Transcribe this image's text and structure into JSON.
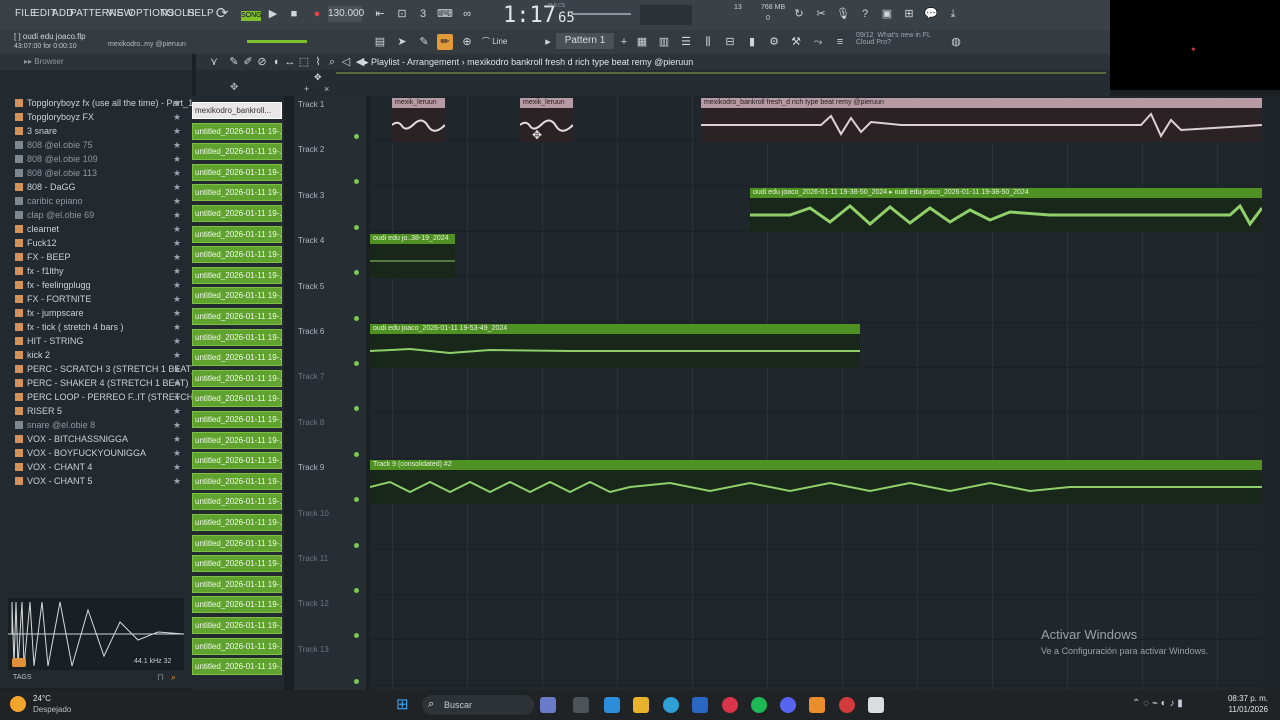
{
  "menu": [
    "FILE",
    "EDIT",
    "ADD",
    "PATTERNS",
    "VIEW",
    "OPTIONS",
    "TOOLS",
    "HELP"
  ],
  "transport": {
    "song_badge": "SONG",
    "tempo": "130.000",
    "time": "1:17",
    "time_sub": "65",
    "time_tag": "M:S:CS",
    "cpu": "13",
    "mem": "768 MB",
    "mem2": "0"
  },
  "project": {
    "file": "oudi edu joaco.flp",
    "elapsed": "43:07:00 for 0:00:10",
    "hint": "mexikodro..my @pieruun"
  },
  "toolbar2": {
    "line_mode": "Line",
    "pattern": "Pattern 1",
    "news_date": "09/12",
    "news_text1": "What's new in FL",
    "news_text2": "Cloud Pro?"
  },
  "browser": {
    "title": "Browser",
    "items": [
      {
        "name": "Topgloryboyz fx (use all the time) - Part_1",
        "dim": false
      },
      {
        "name": "Topgloryboyz FX",
        "dim": false
      },
      {
        "name": "3 snare",
        "dim": false
      },
      {
        "name": "808 @el.obie 75",
        "dim": true
      },
      {
        "name": "808 @el.obie 109",
        "dim": true
      },
      {
        "name": "808 @el.obie 113",
        "dim": true
      },
      {
        "name": "808 - DaGG",
        "dim": false
      },
      {
        "name": "caribic epiano",
        "dim": true
      },
      {
        "name": "clap @el.obie 69",
        "dim": true
      },
      {
        "name": "clearnet",
        "dim": false
      },
      {
        "name": "Fuck12",
        "dim": false
      },
      {
        "name": "FX - BEEP",
        "dim": false
      },
      {
        "name": "fx - f1lthy",
        "dim": false
      },
      {
        "name": "fx - feelingplugg",
        "dim": false
      },
      {
        "name": "FX - FORTNITE",
        "dim": false
      },
      {
        "name": "fx - jumpscare",
        "dim": false
      },
      {
        "name": "fx - tick ( stretch 4 bars )",
        "dim": false
      },
      {
        "name": "HIT - STRING",
        "dim": false
      },
      {
        "name": "kick 2",
        "dim": false
      },
      {
        "name": "PERC - SCRATCH 3 (STRETCH 1 BEAT)",
        "dim": false
      },
      {
        "name": "PERC - SHAKER 4 (STRETCH 1 BEAT)",
        "dim": false
      },
      {
        "name": "PERC LOOP - PERREO F..IT (STRETCH 4 BARS)",
        "dim": false
      },
      {
        "name": "RISER 5",
        "dim": false
      },
      {
        "name": "snare @el.obie 8",
        "dim": true
      },
      {
        "name": "VOX - BITCHASSNIGGA",
        "dim": false
      },
      {
        "name": "VOX - BOYFUCKYOUNIGGA",
        "dim": false
      },
      {
        "name": "VOX - CHANT 4",
        "dim": false
      },
      {
        "name": "VOX - CHANT 5",
        "dim": false
      }
    ],
    "sample_rate": "44.1 kHz 32",
    "tags": "TAGS"
  },
  "playlist": {
    "breadcrumb": "Playlist - Arrangement › mexikodro bankroll fresh d rich type beat remy @pieruun"
  },
  "channels": {
    "first": "mexikodro_bankroll...",
    "item": "untitled_2026-01-11 19-...",
    "count": 28
  },
  "tracks": [
    "Track 1",
    "Track 2",
    "Track 3",
    "Track 4",
    "Track 5",
    "Track 6",
    "Track 7",
    "Track 8",
    "Track 9",
    "Track 10",
    "Track 11",
    "Track 12",
    "Track 13"
  ],
  "clips": {
    "c1": "mexik_leruun",
    "c2": "mexik_leruun",
    "c3": "mexikodro_bankroll fresh_d rich type beat remy @pieruun",
    "c4": "oudi edu joaco_2026-01-11 19-38-50_2024",
    "c4b": "oudi edu joaco_2026-01-11 19-38-50_2024",
    "c5": "oudi edu jo..38-19_2024",
    "c6": "oudi edu joaco_2026-01-11 19-53-49_2024",
    "c7": "Track 9 (consolidated) #2"
  },
  "watermark": {
    "title": "Activar Windows",
    "sub": "Ve a Configuración para activar Windows."
  },
  "taskbar": {
    "weather_temp": "24°C",
    "weather_desc": "Despejado",
    "search": "Buscar",
    "time": "08:37 p. m.",
    "date": "11/01/2026"
  }
}
